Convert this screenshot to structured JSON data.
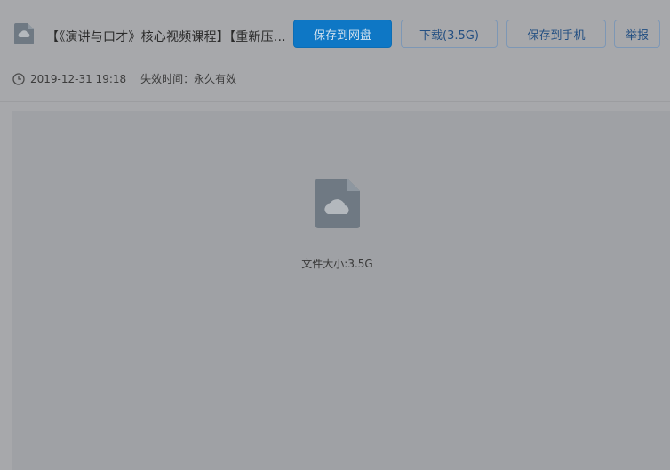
{
  "file": {
    "title": "【《演讲与口才》核心视频课程】【重新压...",
    "date": "2019-12-31 19:18",
    "expire": "失效时间：永久有效",
    "size_label": "文件大小:3.5G",
    "icon": "cloud-file-icon"
  },
  "toolbar": {
    "save_netdisk_label": "保存到网盘",
    "download_label": "下载(3.5G)",
    "save_phone_label": "保存到手机",
    "report_label": "举报"
  },
  "colors": {
    "primary": "#0e77c5",
    "background": "#a7a8ab",
    "preview_background": "#9fa1a5"
  }
}
